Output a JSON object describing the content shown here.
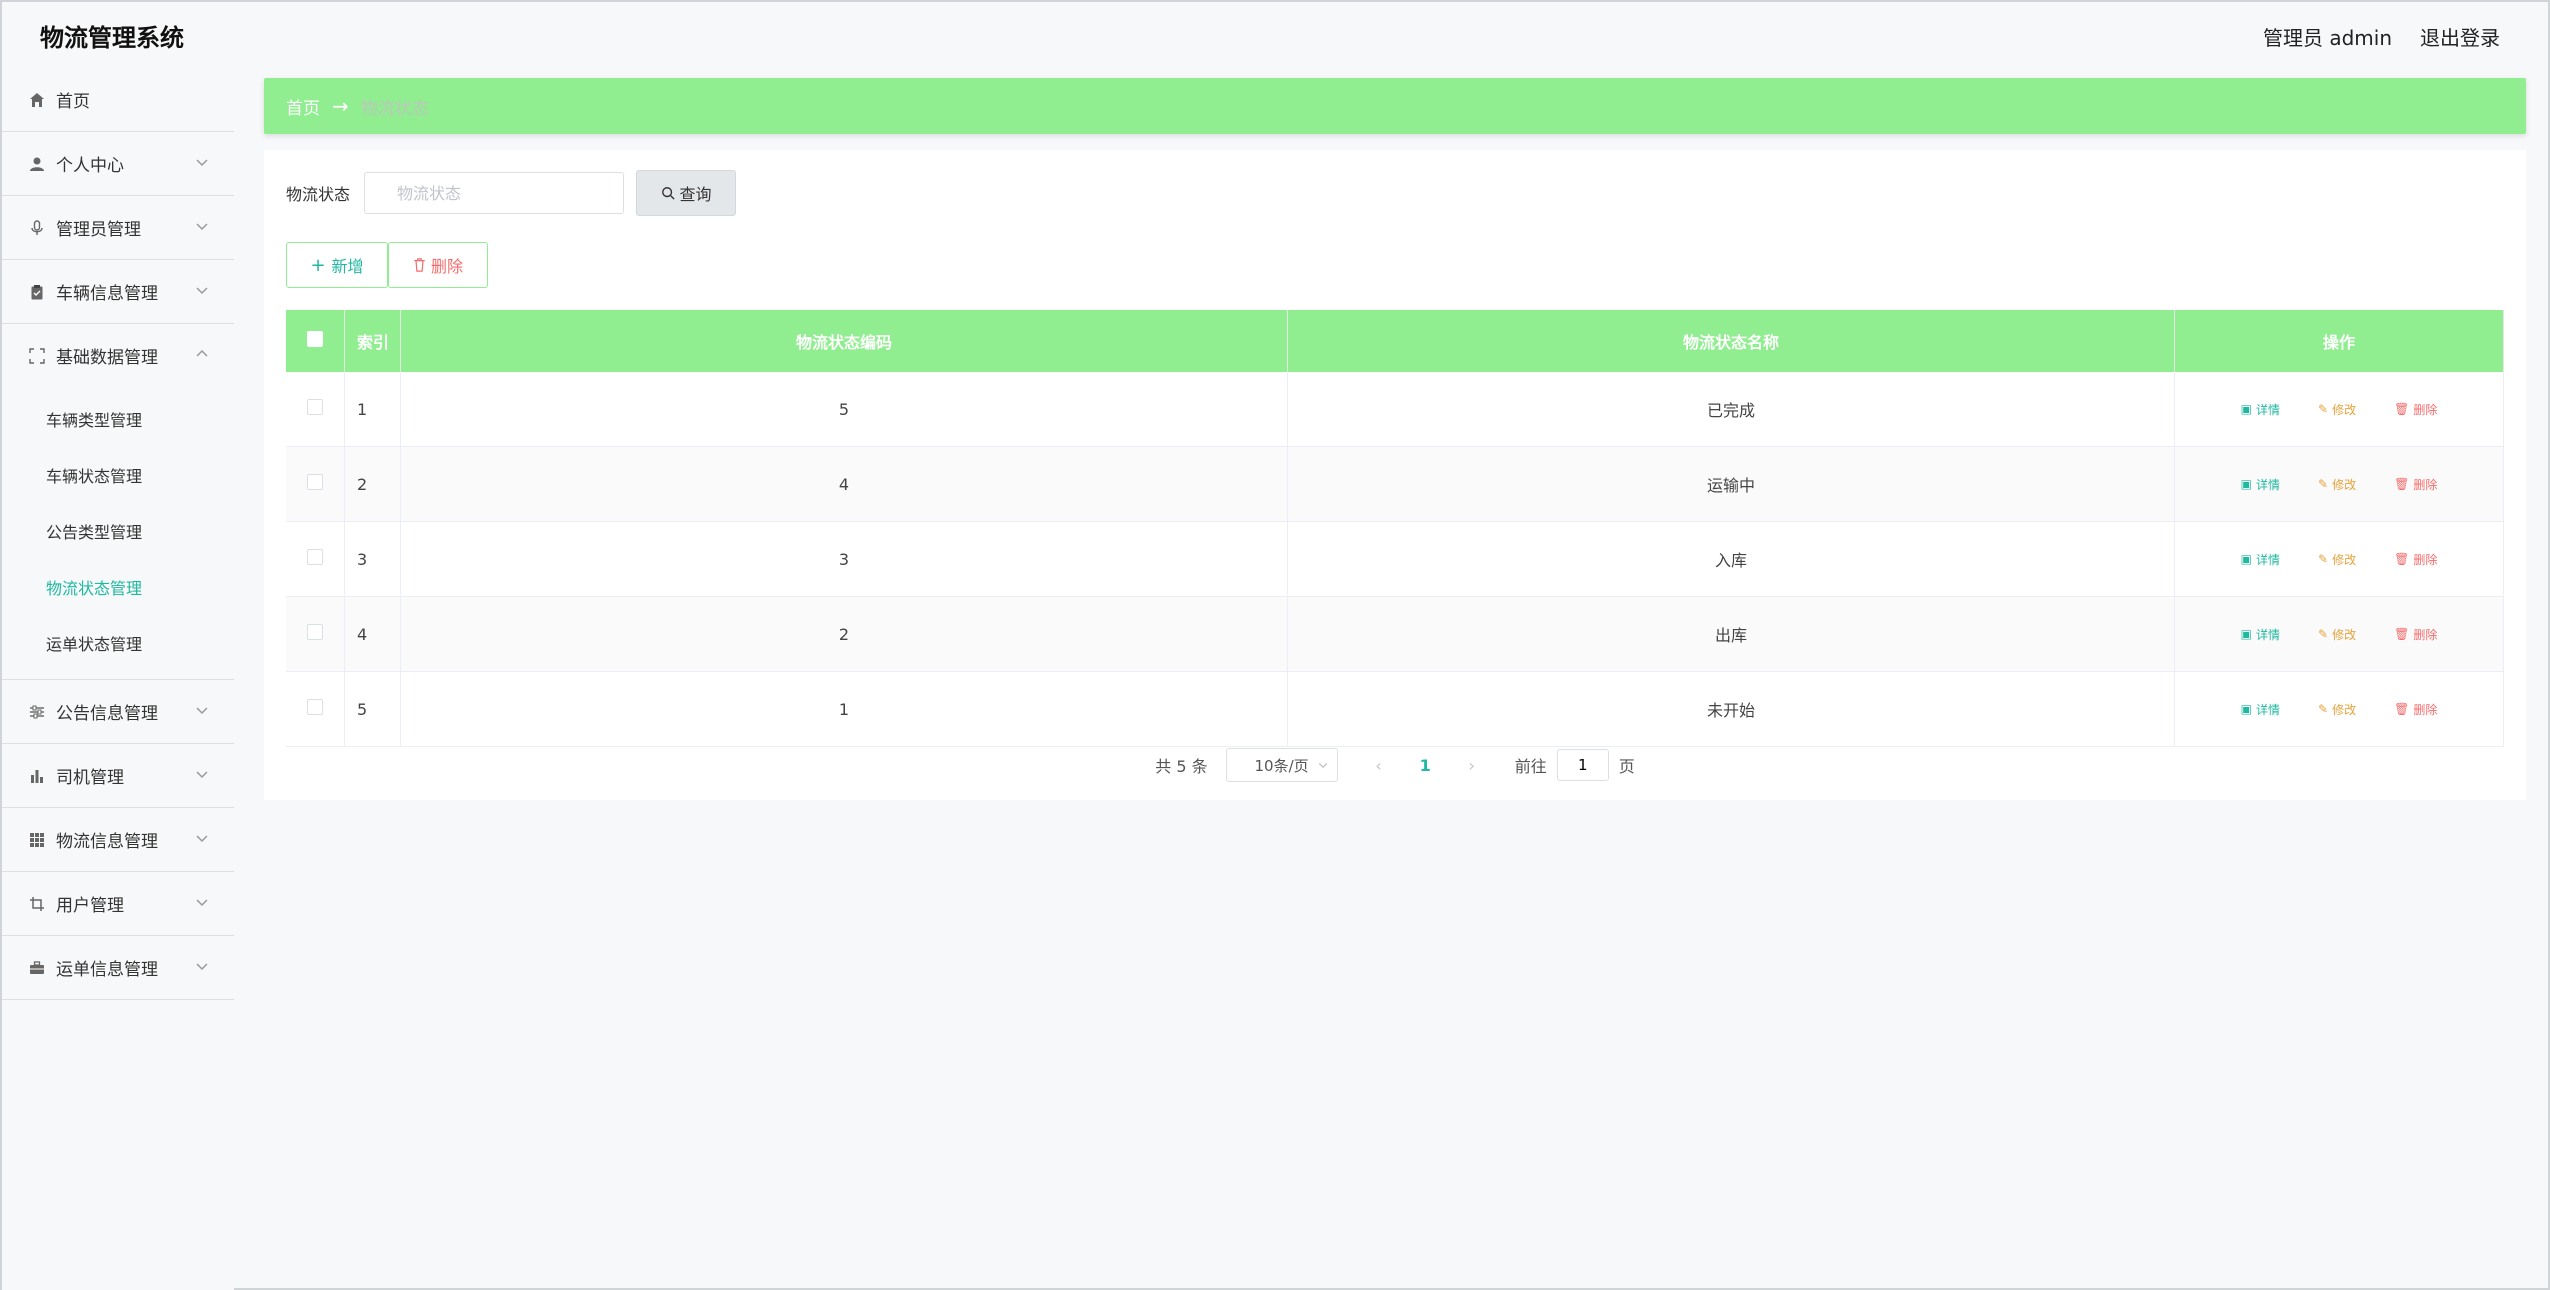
{
  "header": {
    "title": "物流管理系统",
    "user": "管理员 admin",
    "logout": "退出登录"
  },
  "sidebar": {
    "items": [
      {
        "label": "首页",
        "icon": "home-icon"
      },
      {
        "label": "个人中心",
        "icon": "user-icon"
      },
      {
        "label": "管理员管理",
        "icon": "mic-icon"
      },
      {
        "label": "车辆信息管理",
        "icon": "clipboard-icon"
      },
      {
        "label": "基础数据管理",
        "icon": "fullscreen-icon"
      },
      {
        "label": "公告信息管理",
        "icon": "sliders-icon"
      },
      {
        "label": "司机管理",
        "icon": "bar-chart-icon"
      },
      {
        "label": "物流信息管理",
        "icon": "grid-icon"
      },
      {
        "label": "用户管理",
        "icon": "crop-icon"
      },
      {
        "label": "运单信息管理",
        "icon": "briefcase-icon"
      }
    ],
    "sub_items": [
      "车辆类型管理",
      "车辆状态管理",
      "公告类型管理",
      "物流状态管理",
      "运单状态管理"
    ],
    "active_sub": "物流状态管理"
  },
  "breadcrumb": {
    "home": "首页",
    "arrow": "→",
    "current": "物流状态"
  },
  "search": {
    "label": "物流状态",
    "placeholder": "物流状态",
    "button": "查询"
  },
  "actions": {
    "add": "新增",
    "delete": "删除"
  },
  "table": {
    "headers": [
      "索引",
      "物流状态编码",
      "物流状态名称",
      "操作"
    ],
    "rows": [
      {
        "index": "1",
        "code": "5",
        "name": "已完成"
      },
      {
        "index": "2",
        "code": "4",
        "name": "运输中"
      },
      {
        "index": "3",
        "code": "3",
        "name": "入库"
      },
      {
        "index": "4",
        "code": "2",
        "name": "出库"
      },
      {
        "index": "5",
        "code": "1",
        "name": "未开始"
      }
    ],
    "ops": {
      "detail": "详情",
      "edit": "修改",
      "delete": "删除"
    }
  },
  "pagination": {
    "total": "共 5 条",
    "page_size": "10条/页",
    "current": "1",
    "goto_prefix": "前往",
    "goto_value": "1",
    "goto_suffix": "页"
  },
  "colors": {
    "accent": "#90ee90",
    "active_text": "#1fb8a0",
    "danger": "#f56c6c",
    "warning": "#e6a23c"
  }
}
